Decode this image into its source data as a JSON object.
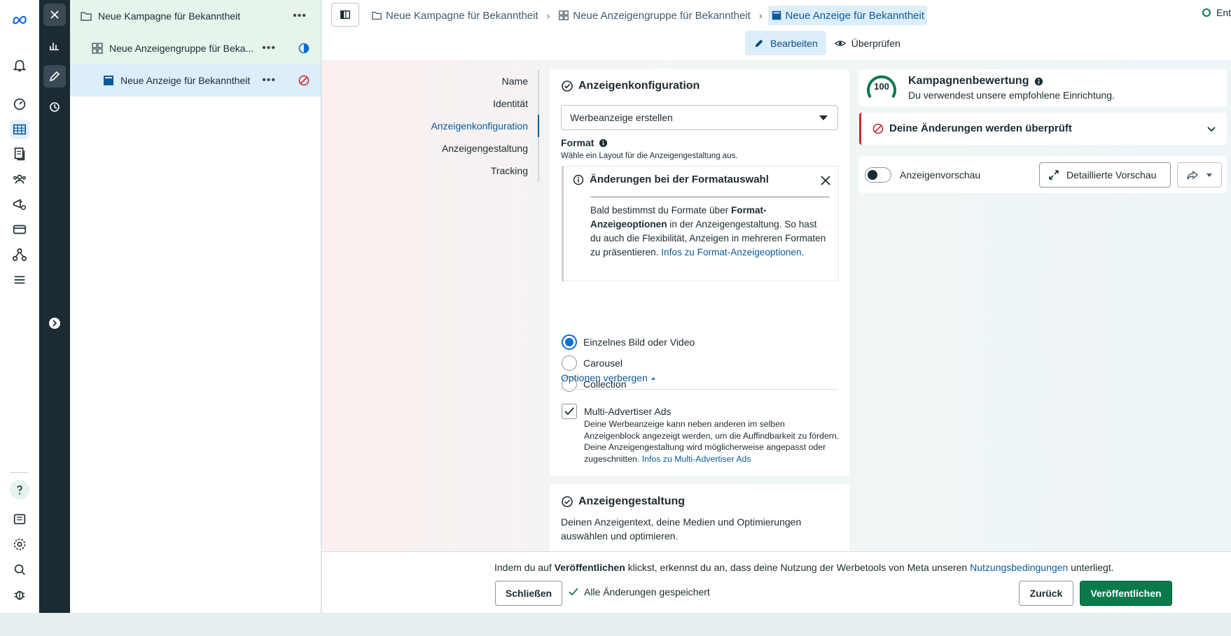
{
  "breadcrumbs": [
    {
      "label": "Neue Kampagne für Bekanntheit"
    },
    {
      "label": "Neue Anzeigengruppe für Bekanntheit"
    },
    {
      "label": "Neue Anzeige für Bekanntheit"
    }
  ],
  "top_right_status": "Ent",
  "mode_tabs": {
    "edit": "Bearbeiten",
    "review": "Überprüfen"
  },
  "tree": {
    "campaign": "Neue Kampagne für Bekanntheit",
    "adset": "Neue Anzeigengruppe für Beka...",
    "ad": "Neue Anzeige für Bekanntheit",
    "more": "•••"
  },
  "sidenav": {
    "items": [
      "Name",
      "Identität",
      "Anzeigenkonfiguration",
      "Anzeigengestaltung",
      "Tracking"
    ],
    "active_index": 2
  },
  "config": {
    "title": "Anzeigenkonfiguration",
    "select_value": "Werbeanzeige erstellen",
    "format_label": "Format",
    "format_sub": "Wähle ein Layout für die Anzeigengestaltung aus.",
    "info_title": "Änderungen bei der Formatauswahl",
    "info_text_1": "Bald bestimmst du Formate über ",
    "info_text_bold": "Format-Anzeigeoptionen",
    "info_text_2": " in der Anzeigengestaltung. So hast du auch die Flexibilität, Anzeigen in mehreren Formaten zu präsentieren. ",
    "info_link": "Infos zu Format-Anzeigeoptionen",
    "info_end": ".",
    "radio_options": [
      "Einzelnes Bild oder Video",
      "Carousel",
      "Collection"
    ],
    "radio_selected": 0,
    "options_toggle": "Optionen verbergen",
    "multi_label": "Multi-Advertiser Ads",
    "multi_checked": true,
    "multi_desc": "Deine Werbeanzeige kann neben anderen im selben Anzeigenblock angezeigt werden, um die Auffindbarkeit zu fördern. Deine Anzeigengestaltung wird möglicherweise angepasst oder zugeschnitten. ",
    "multi_link": "Infos zu Multi-Advertiser Ads"
  },
  "design": {
    "title": "Anzeigengestaltung",
    "desc": "Deinen Anzeigentext, deine Medien und Optimierungen auswählen und optimieren."
  },
  "score": {
    "value": "100",
    "title": "Kampagnenbewertung",
    "sub": "Du verwendest unsere empfohlene Einrichtung."
  },
  "review": {
    "title": "Deine Änderungen werden überprüft"
  },
  "preview": {
    "label": "Anzeigenvorschau",
    "detail_button": "Detaillierte Vorschau"
  },
  "footer": {
    "note_1": "Indem du auf ",
    "note_bold": "Veröffentlichen",
    "note_2": " klickst, erkennst du an, dass deine Nutzung der Werbetools von Meta unseren ",
    "note_link": "Nutzungsbedingungen",
    "note_3": " unterliegt.",
    "close": "Schließen",
    "saved": "Alle Änderungen gespeichert",
    "back": "Zurück",
    "publish": "Veröffentlichen"
  },
  "colors": {
    "accent": "#0a5a9c",
    "publish": "#0a7a4b",
    "alert": "#c7292f",
    "dark_strip": "#1c2b33"
  }
}
